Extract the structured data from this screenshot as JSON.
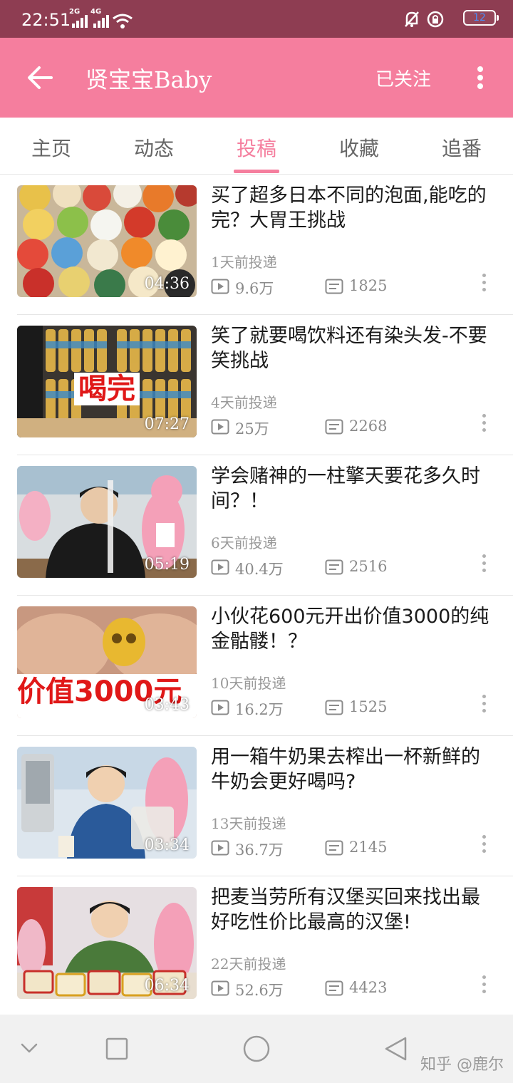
{
  "status_bar": {
    "time": "22:51",
    "signal1_label": "2G",
    "signal2_label": "4G",
    "battery_level": "12"
  },
  "toolbar": {
    "title": "贤宝宝Baby",
    "follow_label": "已关注"
  },
  "tabs": [
    {
      "label": "主页",
      "active": false
    },
    {
      "label": "动态",
      "active": false
    },
    {
      "label": "投稿",
      "active": true
    },
    {
      "label": "收藏",
      "active": false
    },
    {
      "label": "追番",
      "active": false
    }
  ],
  "videos": [
    {
      "title": "买了超多日本不同的泡面,能吃的完？大胃王挑战",
      "duration": "04:36",
      "posted": "1天前投递",
      "views": "9.6万",
      "comments": "1825"
    },
    {
      "title": "笑了就要喝饮料还有染头发-不要笑挑战",
      "duration": "07:27",
      "posted": "4天前投递",
      "views": "25万",
      "comments": "2268",
      "overlay_text": "喝完"
    },
    {
      "title": "学会赌神的一柱擎天要花多久时间？！",
      "duration": "05:19",
      "posted": "6天前投递",
      "views": "40.4万",
      "comments": "2516"
    },
    {
      "title": "小伙花600元开出价值3000的纯金骷髅！？",
      "duration": "03:43",
      "posted": "10天前投递",
      "views": "16.2万",
      "comments": "1525",
      "overlay_text": "价值3000元"
    },
    {
      "title": "用一箱牛奶果去榨出一杯新鲜的牛奶会更好喝吗?",
      "duration": "03:34",
      "posted": "13天前投递",
      "views": "36.7万",
      "comments": "2145"
    },
    {
      "title": "把麦当劳所有汉堡买回来找出最好吃性价比最高的汉堡!",
      "duration": "06:34",
      "posted": "22天前投递",
      "views": "52.6万",
      "comments": "4423"
    }
  ],
  "watermark": "知乎 @鹿尔",
  "colors": {
    "accent": "#f57e9e",
    "status_bar": "#8e3d52",
    "nav_bar": "#f1f1f1"
  }
}
